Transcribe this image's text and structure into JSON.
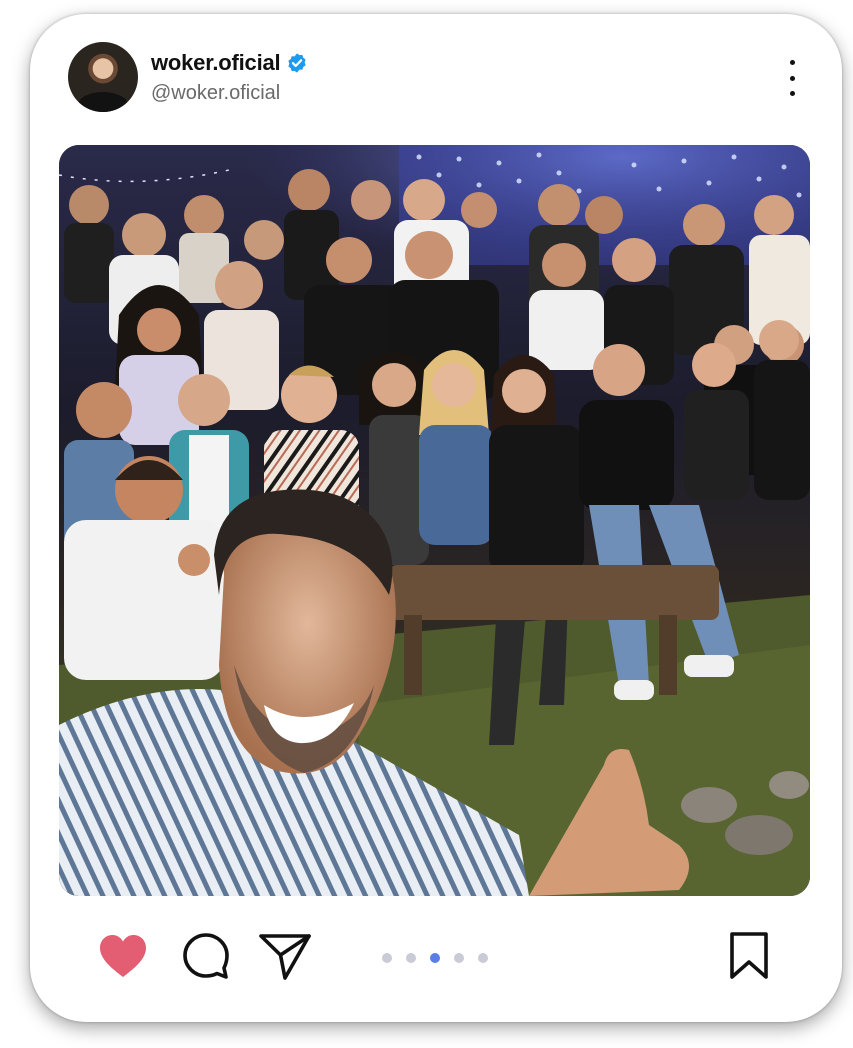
{
  "post": {
    "username": "woker.oficial",
    "handle": "@woker.oficial",
    "verified": true,
    "photo_alt": "Group selfie"
  },
  "icons": {
    "verified": "verified-badge-icon",
    "more": "more-vertical-icon",
    "like": "heart-icon",
    "comment": "comment-icon",
    "share": "send-icon",
    "save": "bookmark-icon"
  },
  "carousel": {
    "count": 5,
    "active_index": 2
  },
  "colors": {
    "like": "#e35d73",
    "verified": "#1d9bf0",
    "active_dot": "#5a7de8",
    "inactive_dot": "#c9ccd6"
  }
}
